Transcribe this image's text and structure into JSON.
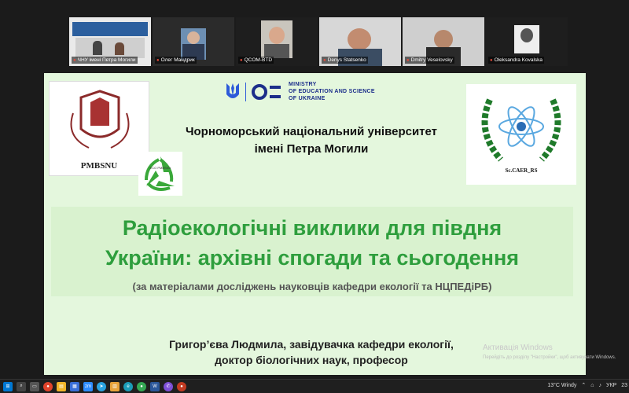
{
  "participants": [
    {
      "name": "ЧНУ імені Петра Могили",
      "active": true
    },
    {
      "name": "Олег Мандрик",
      "active": false
    },
    {
      "name": "QCOM-BTD",
      "active": false
    },
    {
      "name": "Denys Statsenko",
      "active": false
    },
    {
      "name": "Dmitry Veselovsky",
      "active": false
    },
    {
      "name": "Oleksandra Kovalska",
      "active": false
    }
  ],
  "slide": {
    "left_emblem_text": "PMBSNU",
    "recycle_text": "ECO PMBSNU",
    "ministry_lines": [
      "MINISTRY",
      "OF EDUCATION AND SCIENCE",
      "OF UKRAINE"
    ],
    "university_line1": "Чорноморський національний університет",
    "university_line2": "імені Петра Могили",
    "right_emblem_text": "Sc.CAER_RS",
    "title_line1": "Радіоекологічні виклики для півдня",
    "title_line2": "України: архівні спогади та сьогодення",
    "subtitle": "(за матеріалами досліджень науковців кафедри екології та НЦПЕДіРБ)",
    "author_line1": "Григор’єва Людмила, завідувачка кафедри екології,",
    "author_line2": "доктор біологічних наук, професор"
  },
  "watermark": {
    "line1": "Активація Windows",
    "line2": "Перейдіть до розділу \"Настройки\", щоб активувати Windows."
  },
  "taskbar": {
    "weather": "13°C  Windy",
    "language": "УКР",
    "time": "23"
  },
  "colors": {
    "accent_green": "#2e9e3d",
    "slide_bg": "#e4f7dd",
    "ministry_blue": "#1c2e8a"
  }
}
